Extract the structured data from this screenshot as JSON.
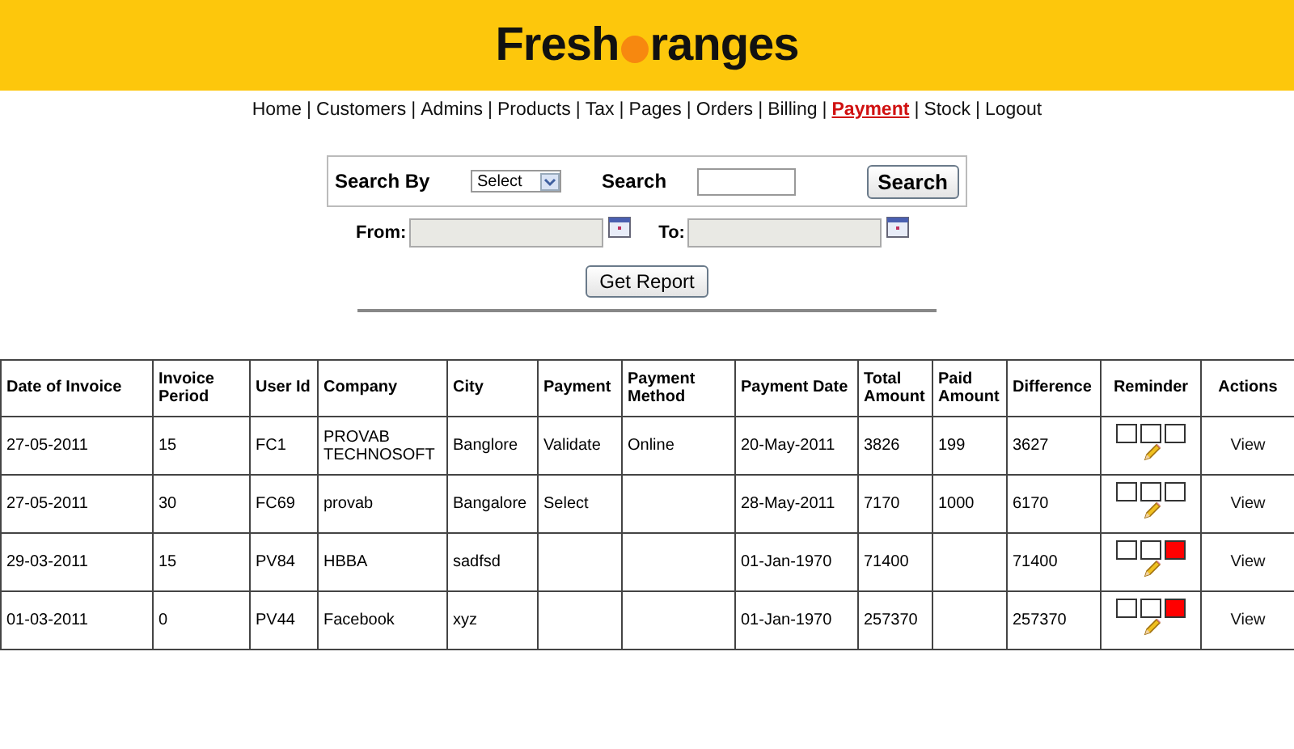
{
  "logo": {
    "before": "Fresh",
    "after": "ranges"
  },
  "nav_separator": "|",
  "nav": [
    {
      "label": "Home",
      "selected": false
    },
    {
      "label": "Customers",
      "selected": false
    },
    {
      "label": "Admins",
      "selected": false
    },
    {
      "label": "Products",
      "selected": false
    },
    {
      "label": "Tax",
      "selected": false
    },
    {
      "label": "Pages",
      "selected": false
    },
    {
      "label": "Orders",
      "selected": false
    },
    {
      "label": "Billing",
      "selected": false
    },
    {
      "label": "Payment",
      "selected": true
    },
    {
      "label": "Stock",
      "selected": false
    },
    {
      "label": "Logout",
      "selected": false
    }
  ],
  "search": {
    "by_label": "Search By",
    "select_value": "Select",
    "search_label": "Search",
    "button": "Search"
  },
  "dates": {
    "from_label": "From:",
    "to_label": "To:",
    "button": "Get Report"
  },
  "table": {
    "columns": [
      "Date of Invoice",
      "Invoice Period",
      "User Id",
      "Company",
      "City",
      "Payment",
      "Payment Method",
      "Payment Date",
      "Total Amount",
      "Paid Amount",
      "Difference",
      "Reminder",
      "Actions"
    ],
    "rows": [
      {
        "cells": [
          "27-05-2011",
          "15",
          "FC1",
          "PROVAB TECHNOSOFT",
          "Banglore",
          "Validate",
          "Online",
          "20-May-2011",
          "3826",
          "199",
          "3627"
        ],
        "reminders": [
          {
            "filled": false
          },
          {
            "filled": false
          },
          {
            "filled": false
          }
        ],
        "action": "View"
      },
      {
        "cells": [
          "27-05-2011",
          "30",
          "FC69",
          "provab",
          "Bangalore",
          "Select",
          "",
          "28-May-2011",
          "7170",
          "1000",
          "6170"
        ],
        "reminders": [
          {
            "filled": false
          },
          {
            "filled": false
          },
          {
            "filled": false
          }
        ],
        "action": "View"
      },
      {
        "cells": [
          "29-03-2011",
          "15",
          "PV84",
          "HBBA",
          "sadfsd",
          "",
          "",
          "01-Jan-1970",
          "71400",
          "",
          "71400"
        ],
        "reminders": [
          {
            "filled": false
          },
          {
            "filled": false
          },
          {
            "filled": true
          }
        ],
        "action": "View"
      },
      {
        "cells": [
          "01-03-2011",
          "0",
          "PV44",
          "Facebook",
          "xyz",
          "",
          "",
          "01-Jan-1970",
          "257370",
          "",
          "257370"
        ],
        "reminders": [
          {
            "filled": false
          },
          {
            "filled": false
          },
          {
            "filled": true
          }
        ],
        "action": "View"
      }
    ]
  }
}
